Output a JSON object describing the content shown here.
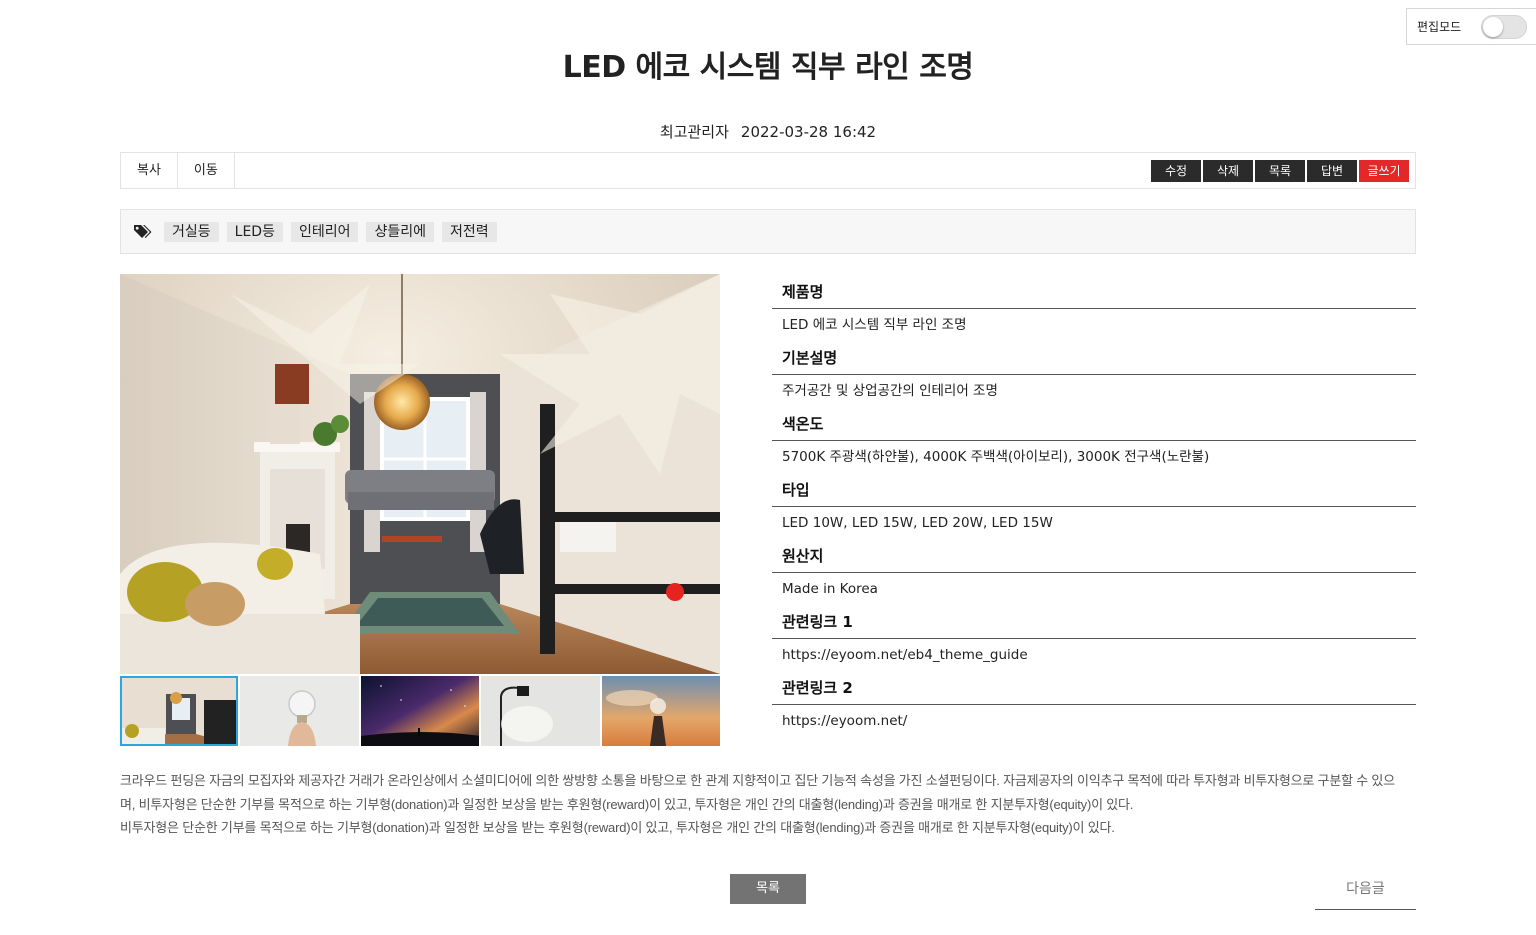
{
  "edit_mode": {
    "label": "편집모드",
    "enabled": false
  },
  "post": {
    "title": "LED 에코 시스템 직부 라인 조명",
    "author": "최고관리자",
    "datetime": "2022-03-28 16:42"
  },
  "toolbar": {
    "left": [
      "복사",
      "이동"
    ],
    "right": [
      "수정",
      "삭제",
      "목록",
      "답변",
      "글쓰기"
    ]
  },
  "tags": {
    "icon": "tags-icon",
    "items": [
      "거실등",
      "LED등",
      "인테리어",
      "샹들리에",
      "저전력"
    ]
  },
  "gallery": {
    "main": "living-room-photo",
    "thumbnails": [
      "living-room-photo",
      "light-bulb-hand-photo",
      "starry-sky-photo",
      "floor-lamp-photo",
      "sunset-bulb-photo"
    ],
    "active_index": 0
  },
  "info": [
    {
      "label": "제품명",
      "value": "LED 에코 시스템 직부 라인 조명"
    },
    {
      "label": "기본설명",
      "value": "주거공간 및 상업공간의 인테리어 조명"
    },
    {
      "label": "색온도",
      "value": "5700K 주광색(하얀불), 4000K 주백색(아이보리), 3000K 전구색(노란불)"
    },
    {
      "label": "타입",
      "value": "LED 10W, LED 15W, LED 20W, LED 15W"
    },
    {
      "label": "원산지",
      "value": "Made in Korea"
    },
    {
      "label": "관련링크 1",
      "value": "https://eyoom.net/eb4_theme_guide"
    },
    {
      "label": "관련링크 2",
      "value": "https://eyoom.net/"
    }
  ],
  "description": [
    "크라우드 펀딩은 자금의 모집자와 제공자간 거래가 온라인상에서 소셜미디어에 의한 쌍방향 소통을 바탕으로 한 관계 지향적이고 집단 기능적 속성을 가진 소셜펀딩이다. 자금제공자의 이익추구 목적에 따라 투자형과 비투자형으로 구분할 수 있으며, 비투자형은 단순한 기부를 목적으로 하는 기부형(donation)과 일정한 보상을 받는 후원형(reward)이 있고, 투자형은 개인 간의 대출형(lending)과 증권을 매개로 한 지분투자형(equity)이 있다.",
    "비투자형은 단순한 기부를 목적으로 하는 기부형(donation)과 일정한 보상을 받는 후원형(reward)이 있고, 투자형은 개인 간의 대출형(lending)과 증권을 매개로 한 지분투자형(equity)이 있다."
  ],
  "footer": {
    "list_label": "목록",
    "next_label": "다음글"
  }
}
